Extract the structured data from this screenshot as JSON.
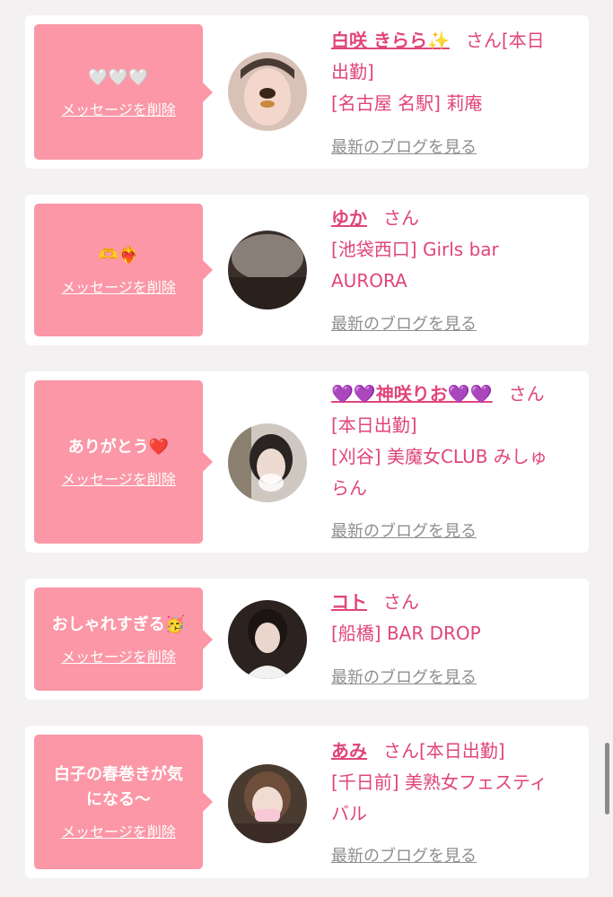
{
  "cards": [
    {
      "message": "🤍🤍🤍",
      "delete_label": "メッセージを削除",
      "name": "白咲 きらら✨",
      "san": "さん",
      "line1_suffix": "[本日",
      "lines": [
        "出勤]",
        "[名古屋 名駅] 莉庵"
      ],
      "blog_label": "最新のブログを見る"
    },
    {
      "message": "🫶❤️‍🔥",
      "delete_label": "メッセージを削除",
      "name": "ゆか",
      "san": "さん",
      "line1_suffix": "",
      "lines": [
        "[池袋西口] Girls bar",
        "AURORA"
      ],
      "blog_label": "最新のブログを見る"
    },
    {
      "message": "ありがとう❤️",
      "delete_label": "メッセージを削除",
      "name": "💜💜神咲りお💜💜",
      "san": "さん",
      "line1_suffix": "",
      "lines": [
        "[本日出勤]",
        "[刈谷] 美魔女CLUB みしゅ",
        "らん"
      ],
      "blog_label": "最新のブログを見る"
    },
    {
      "message": "おしゃれすぎる🥳",
      "delete_label": "メッセージを削除",
      "name": "コト",
      "san": "さん",
      "line1_suffix": "",
      "lines": [
        "[船橋] BAR DROP"
      ],
      "blog_label": "最新のブログを見る"
    },
    {
      "message": "白子の春巻きが気\nになる〜",
      "delete_label": "メッセージを削除",
      "name": "あみ",
      "san": "さん",
      "line1_suffix": "[本日出勤]",
      "lines": [
        "[千日前] 美熟女フェスティ",
        "バル"
      ],
      "blog_label": "最新のブログを見る"
    }
  ],
  "colors": {
    "bubble": "#fb97a6",
    "name": "#e0457b",
    "link_gray": "#8e8e8e",
    "background": "#f4f1f2"
  },
  "icons": [
    "avatar-photo"
  ]
}
